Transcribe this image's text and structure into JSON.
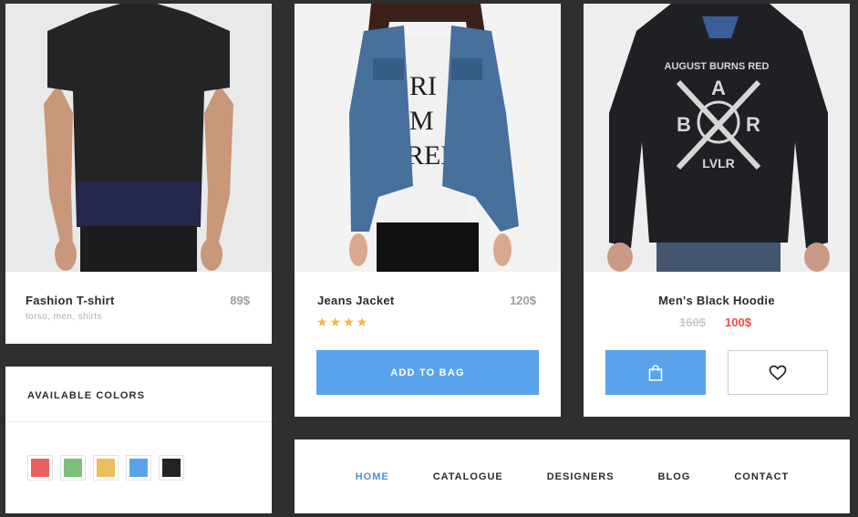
{
  "products": [
    {
      "name": "Fashion T-shirt",
      "price": "89$",
      "tags": "torso, men, shirts"
    },
    {
      "name": "Jeans Jacket",
      "price": "120$",
      "rating": 4,
      "stars": "★★★★",
      "cta": "ADD TO BAG"
    },
    {
      "name": "Men's Black Hoodie",
      "old_price": "160$",
      "new_price": "100$",
      "hoodie_print": {
        "line1": "AUGUST BURNS RED",
        "letters": [
          "A",
          "B",
          "R"
        ],
        "line2": "LVLR"
      }
    }
  ],
  "jacket_shirt_print": [
    "RI",
    "M",
    "REN"
  ],
  "colors": {
    "title": "AVAILABLE COLORS",
    "swatches": [
      "#e9605e",
      "#7ebf7a",
      "#ecbd58",
      "#59a4e8",
      "#232323"
    ]
  },
  "nav": {
    "items": [
      "HOME",
      "CATALOGUE",
      "DESIGNERS",
      "BLOG",
      "CONTACT"
    ],
    "active": "HOME"
  },
  "theme": {
    "accent": "#5aa2ec",
    "star": "#f3b640",
    "sale": "#ec4b48",
    "background": "#2f2f2f"
  },
  "icons": {
    "bag": "shopping-bag-icon",
    "wishlist": "heart-icon"
  }
}
